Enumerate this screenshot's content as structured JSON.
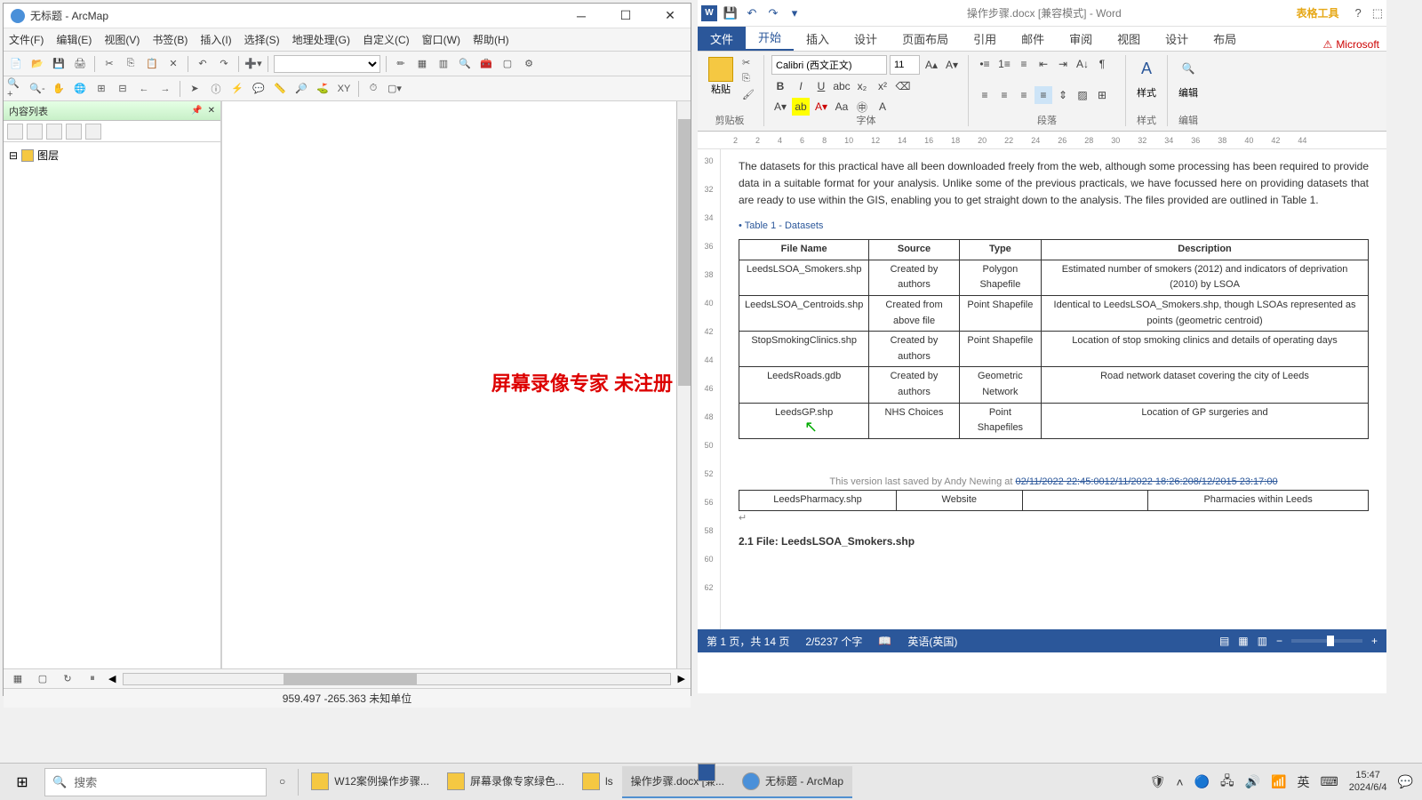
{
  "arcmap": {
    "title": "无标题 - ArcMap",
    "menu": [
      "文件(F)",
      "编辑(E)",
      "视图(V)",
      "书签(B)",
      "插入(I)",
      "选择(S)",
      "地理处理(G)",
      "自定义(C)",
      "窗口(W)",
      "帮助(H)"
    ],
    "toc_title": "内容列表",
    "layer_root": "图层",
    "coords": "959.497 -265.363 未知单位",
    "watermark": "屏幕录像专家  未注册"
  },
  "word": {
    "doc_title": "操作步骤.docx [兼容模式] - Word",
    "table_tools": "表格工具",
    "tabs": [
      "文件",
      "开始",
      "插入",
      "设计",
      "页面布局",
      "引用",
      "邮件",
      "审阅",
      "视图",
      "设计",
      "布局"
    ],
    "active_tab": "开始",
    "ms_warning": "Microsoft",
    "font_name": "Calibri (西文正文)",
    "font_size": "11",
    "groups": {
      "clipboard": "剪贴板",
      "font": "字体",
      "paragraph": "段落",
      "styles": "样式",
      "editing": "编辑"
    },
    "paste_label": "粘贴",
    "styles_label": "样式",
    "editing_label": "编辑",
    "ruler_marks": [
      "2",
      "2",
      "4",
      "6",
      "8",
      "10",
      "12",
      "14",
      "16",
      "18",
      "20",
      "22",
      "24",
      "26",
      "28",
      "30",
      "32",
      "34",
      "36",
      "38",
      "40",
      "42",
      "44"
    ],
    "vruler_marks": [
      "30",
      "32",
      "34",
      "36",
      "38",
      "40",
      "42",
      "44",
      "46",
      "48",
      "50",
      "52",
      "56",
      "58",
      "60",
      "62"
    ],
    "para1": "The datasets for this practical have all been downloaded freely from the web, although some processing has been required to provide data in a suitable format for your analysis. Unlike some of the previous practicals, we have focussed here on providing datasets that are ready to use within the GIS, enabling you to get straight down to the analysis. The files provided are outlined in Table 1.",
    "table_caption": "Table 1 - Datasets",
    "table_headers": [
      "File Name",
      "Source",
      "Type",
      "Description"
    ],
    "table_rows": [
      {
        "file": "LeedsLSOA_Smokers.shp",
        "source": "Created by authors",
        "type": "Polygon Shapefile",
        "desc": "Estimated number of smokers (2012) and indicators of deprivation (2010) by LSOA"
      },
      {
        "file": "LeedsLSOA_Centroids.shp",
        "source": "Created from above file",
        "type": "Point Shapefile",
        "desc": "Identical to LeedsLSOA_Smokers.shp, though LSOAs represented as points (geometric centroid)"
      },
      {
        "file": "StopSmokingClinics.shp",
        "source": "Created by authors",
        "type": "Point Shapefile",
        "desc": "Location of stop smoking clinics and details of operating days"
      },
      {
        "file": "LeedsRoads.gdb",
        "source": "Created by authors",
        "type": "Geometric Network",
        "desc": "Road network dataset covering the city of Leeds"
      },
      {
        "file": "LeedsGP.shp",
        "source": "NHS Choices",
        "type": "Point Shapefiles",
        "desc": "Location of GP surgeries and"
      }
    ],
    "footer_text": "This version last saved by Andy Newing at ",
    "footer_link": "02/11/2022 22:45:0012/11/2022 18:26:208/12/2015 23:17:00",
    "table2_row": {
      "file": "LeedsPharmacy.shp",
      "source": "Website",
      "type": "",
      "desc": "Pharmacies within Leeds"
    },
    "section_head": "2.1 File: LeedsLSOA_Smokers.shp",
    "status_page": "第 1 页，共 14 页",
    "status_words": "2/5237 个字",
    "status_lang": "英语(英国)"
  },
  "taskbar": {
    "search_placeholder": "搜索",
    "tasks": [
      {
        "label": "W12案例操作步骤...",
        "type": "folder"
      },
      {
        "label": "屏幕录像专家绿色...",
        "type": "folder"
      },
      {
        "label": "ls",
        "type": "folder"
      },
      {
        "label": "操作步骤.docx [兼...",
        "type": "word"
      },
      {
        "label": "无标题 - ArcMap",
        "type": "arc"
      }
    ],
    "ime": "英",
    "time": "15:47",
    "date": "2024/6/4"
  }
}
